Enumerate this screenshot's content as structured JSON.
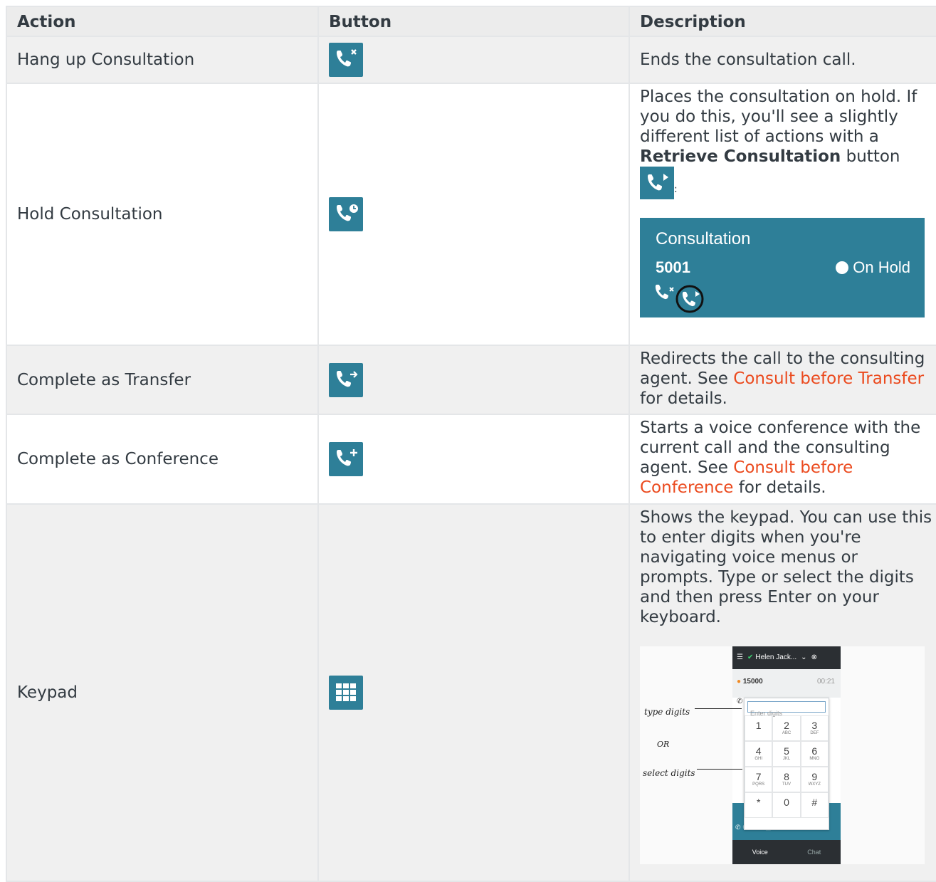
{
  "headers": {
    "action": "Action",
    "button": "Button",
    "description": "Description"
  },
  "rows": {
    "hangup": {
      "action": "Hang up Consultation",
      "desc": "Ends the consultation call.",
      "icon": "hang-up-icon"
    },
    "hold": {
      "action": "Hold Consultation",
      "desc_text": "Places the consultation on hold. If you do this, you'll see a slightly different list of actions with a",
      "desc_bold": "Retrieve Consultation",
      "desc_after": "button",
      "desc_colon": ":",
      "icon": "hold-icon",
      "card": {
        "title": "Consultation",
        "number": "5001",
        "status": "On Hold"
      }
    },
    "transfer": {
      "action": "Complete as Transfer",
      "desc_text": "Redirects the call to the consulting agent. See",
      "link": "Consult before Transfer",
      "desc_after": "for details.",
      "icon": "transfer-icon"
    },
    "conference": {
      "action": "Complete as Conference",
      "desc_text": "Starts a voice conference with the current call and the consulting agent. See",
      "link": "Consult before Conference",
      "desc_after": "for details.",
      "icon": "conference-icon"
    },
    "keypad": {
      "action": "Keypad",
      "desc": "Shows the keypad. You can use this to enter digits when you're navigating voice menus or prompts. Type or select the digits and then press Enter on your keyboard.",
      "icon": "keypad-icon",
      "image": {
        "agent": "Helen Jack...",
        "call_number": "15000",
        "call_time": "00:21",
        "placeholder": "Enter digits",
        "annot_type": "type digits",
        "annot_or": "OR",
        "annot_select": "select digits",
        "keys": [
          {
            "d": "1",
            "l": ""
          },
          {
            "d": "2",
            "l": "ABC"
          },
          {
            "d": "3",
            "l": "DEF"
          },
          {
            "d": "4",
            "l": "GHI"
          },
          {
            "d": "5",
            "l": "JKL"
          },
          {
            "d": "6",
            "l": "MNO"
          },
          {
            "d": "7",
            "l": "PQRS"
          },
          {
            "d": "8",
            "l": "TUV"
          },
          {
            "d": "9",
            "l": "WXYZ"
          },
          {
            "d": "*",
            "l": ""
          },
          {
            "d": "0",
            "l": ""
          },
          {
            "d": "#",
            "l": ""
          }
        ],
        "tab_voice": "Voice",
        "tab_chat": "Chat"
      }
    }
  },
  "colors": {
    "accent": "#2e7f98",
    "link": "#eb4a1e",
    "header_bg": "#ececec"
  }
}
